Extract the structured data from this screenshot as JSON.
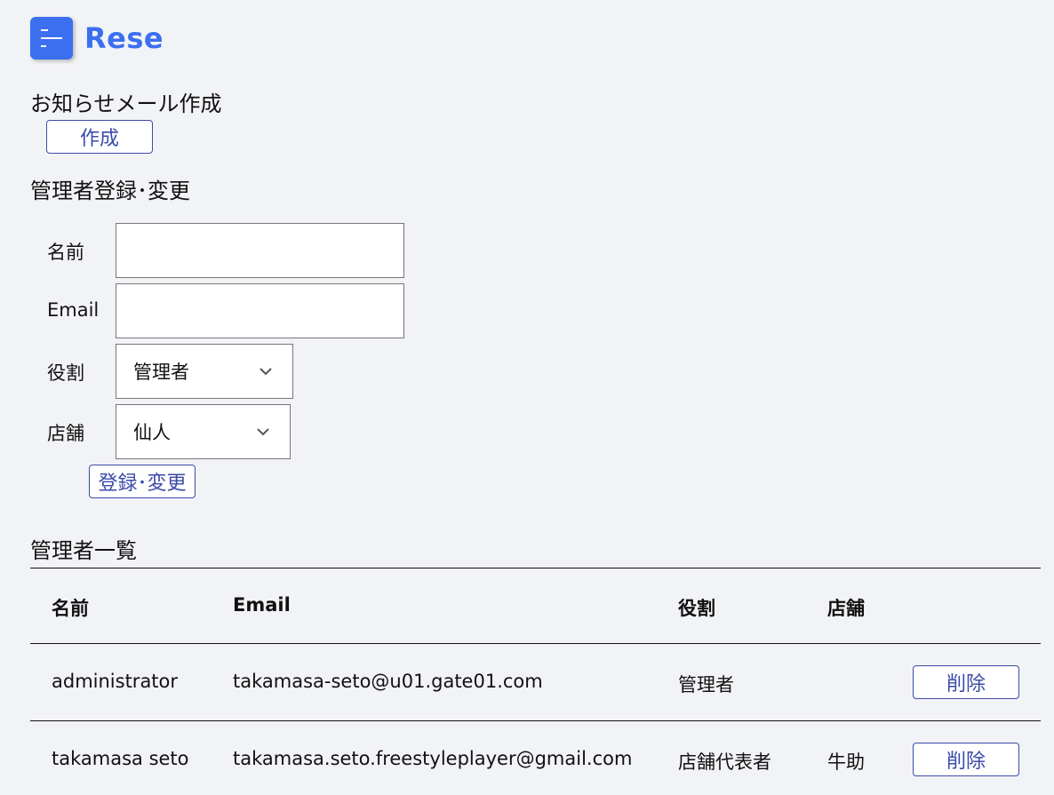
{
  "app": {
    "logo": "Rese"
  },
  "mail_section": {
    "title": "お知らせメール作成",
    "create_label": "作成"
  },
  "register_section": {
    "title": "管理者登録･変更",
    "name_label": "名前",
    "name_value": "",
    "email_label": "Email",
    "email_value": "",
    "role_label": "役割",
    "role_selected": "管理者",
    "store_label": "店舗",
    "store_selected": "仙人",
    "submit_label": "登録･変更"
  },
  "list_section": {
    "title": "管理者一覧",
    "headers": {
      "name": "名前",
      "email": "Email",
      "role": "役割",
      "store": "店舗"
    },
    "rows": [
      {
        "name": "administrator",
        "email": "takamasa-seto@u01.gate01.com",
        "role": "管理者",
        "store": "",
        "delete_label": "削除"
      },
      {
        "name": "takamasa seto",
        "email": "takamasa.seto.freestyleplayer@gmail.com",
        "role": "店舗代表者",
        "store": "牛助",
        "delete_label": "削除"
      }
    ]
  },
  "colors": {
    "accent": "#3b6ff0",
    "button_border": "#3a4aa8",
    "background": "#f2f3f6"
  },
  "icons": {
    "menu": "menu-icon",
    "chevron": "chevron-down-icon"
  }
}
